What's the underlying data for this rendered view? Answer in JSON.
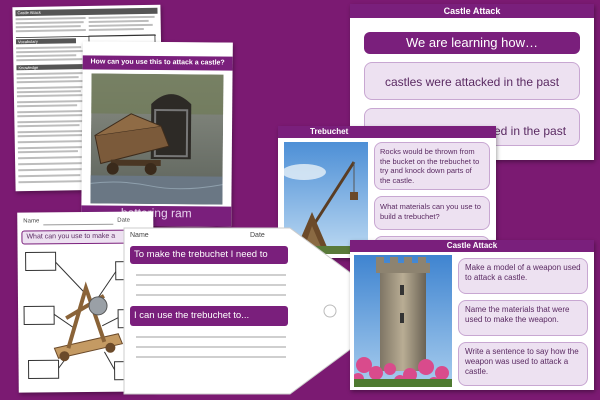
{
  "knowledge_organiser": {
    "title": "Castle Attack",
    "section_vocab": "Vocabulary",
    "section_knowledge": "Knowledge"
  },
  "castle_attack_slide": {
    "title": "Castle Attack",
    "learning_banner": "We are learning how…",
    "objective_1": "castles were attacked in the past",
    "objective_2": "people lived and worked in the past"
  },
  "battering_slide": {
    "question": "How can you use this to attack a castle?",
    "caption": "battering ram"
  },
  "trebuchet_slide": {
    "title": "Trebuchet",
    "fact": "Rocks would be thrown from the bucket on the trebuchet to try and knock down parts of the castle.",
    "question": "What materials can you use to build a trebuchet?"
  },
  "worksheet_left": {
    "name_label": "Name",
    "date_label": "Date",
    "question": "What can you use to make a"
  },
  "worksheet_mid": {
    "name_label": "Name",
    "date_label": "Date",
    "prompt_1": "To make the trebuchet I need to",
    "prompt_2": "I can use the trebuchet to..."
  },
  "castle_attack_tasks": {
    "title": "Castle Attack",
    "task_1": "Make a model of a weapon used to attack a castle.",
    "task_2": "Name the materials that were used to make the weapon.",
    "task_3": "Write a sentence to say how the weapon was used to attack a castle."
  },
  "colors": {
    "background": "#7b1a72",
    "accent": "#7a1f7c",
    "box": "#ede1f1"
  }
}
